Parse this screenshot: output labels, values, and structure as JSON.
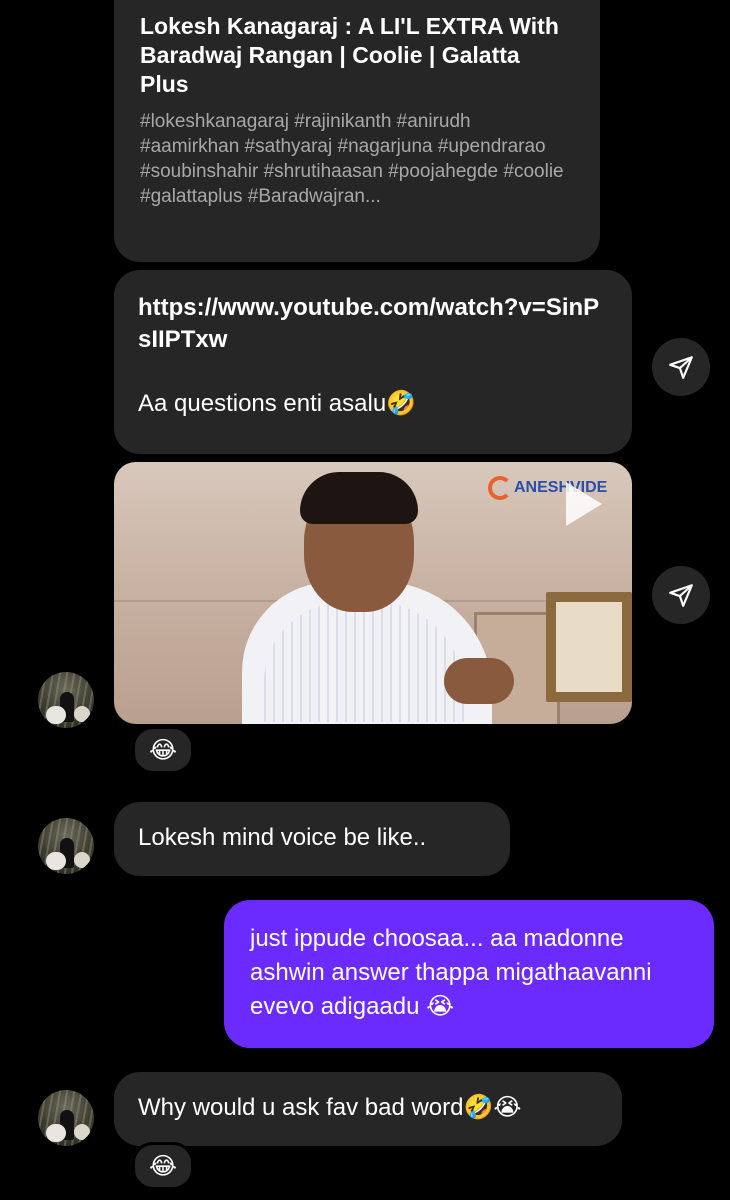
{
  "link_card": {
    "title": "Lokesh Kanagaraj : A LI'L EXTRA With Baradwaj Rangan | Coolie | Galatta Plus",
    "description": "#lokeshkanagaraj #rajinikanth #anirudh #aamirkhan #sathyaraj #nagarjuna #upendrarao #soubinshahir #shrutihaasan #poojahegde #coolie #galattaplus #Baradwajran..."
  },
  "url_message": {
    "url": "https://www.youtube.com/watch?v=SinPsIIPTxw",
    "text": "Aa questions enti asalu🤣"
  },
  "video": {
    "watermark": "ANESHVIDE",
    "icon": "play-icon"
  },
  "reaction_1": "😂",
  "reply_1": "Lokesh mind voice be like..",
  "sent_message": "just ippude choosaa... aa madonne ashwin answer thappa migathaavanni evevo adigaadu 😭",
  "reply_2": "Why would u ask fav bad word🤣😭",
  "reaction_2": "😂",
  "icons": [
    "share-icon",
    "play-icon",
    "avatar"
  ],
  "colors": {
    "background": "#000000",
    "received_bubble": "#262626",
    "sent_bubble": "#6b2bff",
    "secondary_text": "#a8a8a8"
  }
}
